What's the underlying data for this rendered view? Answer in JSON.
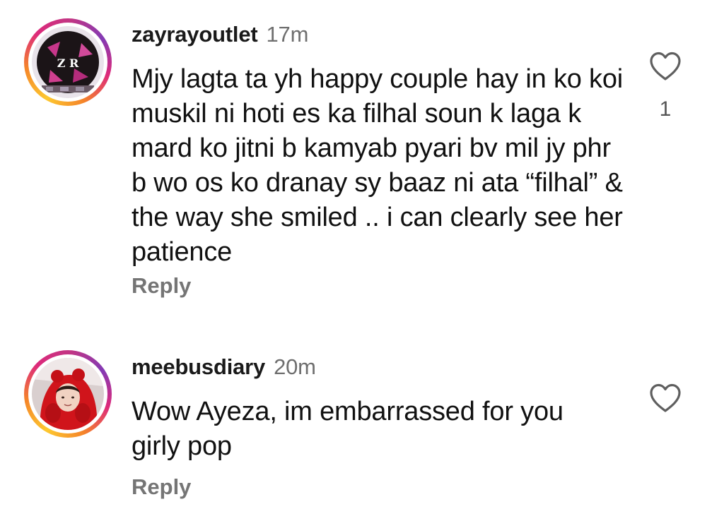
{
  "comments": [
    {
      "username": "zayrayoutlet",
      "time": "17m",
      "avatar_text": "Z R",
      "text": "Mjy lagta ta yh happy couple hay in ko koi muskil ni hoti es ka filhal soun k laga k mard ko jitni b kamyab pyari bv mil jy phr b wo os ko dranay sy baaz ni ata “filhal” & the way she smiled .. i can clearly see her patience",
      "reply_label": "Reply",
      "like_icon": "heart-outline-icon",
      "like_count": "1"
    },
    {
      "username": "meebusdiary",
      "time": "20m",
      "text": "Wow Ayeza, im embarrassed for you girly pop",
      "reply_label": "Reply",
      "like_icon": "heart-outline-icon",
      "like_count": ""
    }
  ],
  "colors": {
    "ring_gradient": [
      "#fdc830",
      "#f58529",
      "#dd2a7b",
      "#c13584",
      "#833ab4"
    ],
    "username": "#1a1a1a",
    "timestamp": "#6f6f6f",
    "reply": "#757575",
    "heart": "#5f5f5f"
  }
}
